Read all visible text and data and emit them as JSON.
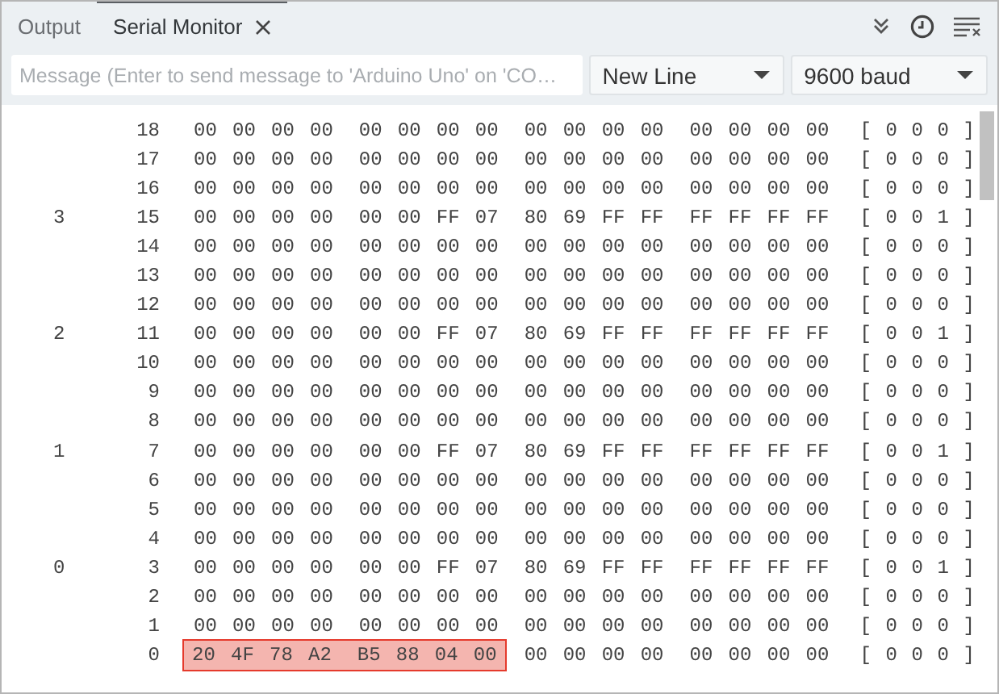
{
  "tabs": [
    {
      "label": "Output",
      "selected": false,
      "closable": false
    },
    {
      "label": "Serial Monitor",
      "selected": true,
      "closable": true
    }
  ],
  "toolbar": {
    "message_field": {
      "placeholder": "Message (Enter to send message to 'Arduino Uno' on 'CO…"
    },
    "line_ending": {
      "value": "New Line"
    },
    "baud_rate": {
      "value": "9600 baud"
    }
  },
  "output": {
    "rows": [
      {
        "sector": "",
        "block": "18",
        "groups": [
          {
            "text": "00 00 00 00",
            "highlighted": false
          },
          {
            "text": "00 00 00 00",
            "highlighted": false
          },
          {
            "text": "00 00 00 00",
            "highlighted": false
          },
          {
            "text": "00 00 00 00",
            "highlighted": false
          }
        ],
        "access": "[ 0 0 0 ]"
      },
      {
        "sector": "",
        "block": "17",
        "groups": [
          {
            "text": "00 00 00 00",
            "highlighted": false
          },
          {
            "text": "00 00 00 00",
            "highlighted": false
          },
          {
            "text": "00 00 00 00",
            "highlighted": false
          },
          {
            "text": "00 00 00 00",
            "highlighted": false
          }
        ],
        "access": "[ 0 0 0 ]"
      },
      {
        "sector": "",
        "block": "16",
        "groups": [
          {
            "text": "00 00 00 00",
            "highlighted": false
          },
          {
            "text": "00 00 00 00",
            "highlighted": false
          },
          {
            "text": "00 00 00 00",
            "highlighted": false
          },
          {
            "text": "00 00 00 00",
            "highlighted": false
          }
        ],
        "access": "[ 0 0 0 ]"
      },
      {
        "sector": "3",
        "block": "15",
        "groups": [
          {
            "text": "00 00 00 00",
            "highlighted": false
          },
          {
            "text": "00 00 FF 07",
            "highlighted": false
          },
          {
            "text": "80 69 FF FF",
            "highlighted": false
          },
          {
            "text": "FF FF FF FF",
            "highlighted": false
          }
        ],
        "access": "[ 0 0 1 ]"
      },
      {
        "sector": "",
        "block": "14",
        "groups": [
          {
            "text": "00 00 00 00",
            "highlighted": false
          },
          {
            "text": "00 00 00 00",
            "highlighted": false
          },
          {
            "text": "00 00 00 00",
            "highlighted": false
          },
          {
            "text": "00 00 00 00",
            "highlighted": false
          }
        ],
        "access": "[ 0 0 0 ]"
      },
      {
        "sector": "",
        "block": "13",
        "groups": [
          {
            "text": "00 00 00 00",
            "highlighted": false
          },
          {
            "text": "00 00 00 00",
            "highlighted": false
          },
          {
            "text": "00 00 00 00",
            "highlighted": false
          },
          {
            "text": "00 00 00 00",
            "highlighted": false
          }
        ],
        "access": "[ 0 0 0 ]"
      },
      {
        "sector": "",
        "block": "12",
        "groups": [
          {
            "text": "00 00 00 00",
            "highlighted": false
          },
          {
            "text": "00 00 00 00",
            "highlighted": false
          },
          {
            "text": "00 00 00 00",
            "highlighted": false
          },
          {
            "text": "00 00 00 00",
            "highlighted": false
          }
        ],
        "access": "[ 0 0 0 ]"
      },
      {
        "sector": "2",
        "block": "11",
        "groups": [
          {
            "text": "00 00 00 00",
            "highlighted": false
          },
          {
            "text": "00 00 FF 07",
            "highlighted": false
          },
          {
            "text": "80 69 FF FF",
            "highlighted": false
          },
          {
            "text": "FF FF FF FF",
            "highlighted": false
          }
        ],
        "access": "[ 0 0 1 ]"
      },
      {
        "sector": "",
        "block": "10",
        "groups": [
          {
            "text": "00 00 00 00",
            "highlighted": false
          },
          {
            "text": "00 00 00 00",
            "highlighted": false
          },
          {
            "text": "00 00 00 00",
            "highlighted": false
          },
          {
            "text": "00 00 00 00",
            "highlighted": false
          }
        ],
        "access": "[ 0 0 0 ]"
      },
      {
        "sector": "",
        "block": "9",
        "groups": [
          {
            "text": "00 00 00 00",
            "highlighted": false
          },
          {
            "text": "00 00 00 00",
            "highlighted": false
          },
          {
            "text": "00 00 00 00",
            "highlighted": false
          },
          {
            "text": "00 00 00 00",
            "highlighted": false
          }
        ],
        "access": "[ 0 0 0 ]"
      },
      {
        "sector": "",
        "block": "8",
        "groups": [
          {
            "text": "00 00 00 00",
            "highlighted": false
          },
          {
            "text": "00 00 00 00",
            "highlighted": false
          },
          {
            "text": "00 00 00 00",
            "highlighted": false
          },
          {
            "text": "00 00 00 00",
            "highlighted": false
          }
        ],
        "access": "[ 0 0 0 ]"
      },
      {
        "sector": "1",
        "block": "7",
        "groups": [
          {
            "text": "00 00 00 00",
            "highlighted": false
          },
          {
            "text": "00 00 FF 07",
            "highlighted": false
          },
          {
            "text": "80 69 FF FF",
            "highlighted": false
          },
          {
            "text": "FF FF FF FF",
            "highlighted": false
          }
        ],
        "access": "[ 0 0 1 ]"
      },
      {
        "sector": "",
        "block": "6",
        "groups": [
          {
            "text": "00 00 00 00",
            "highlighted": false
          },
          {
            "text": "00 00 00 00",
            "highlighted": false
          },
          {
            "text": "00 00 00 00",
            "highlighted": false
          },
          {
            "text": "00 00 00 00",
            "highlighted": false
          }
        ],
        "access": "[ 0 0 0 ]"
      },
      {
        "sector": "",
        "block": "5",
        "groups": [
          {
            "text": "00 00 00 00",
            "highlighted": false
          },
          {
            "text": "00 00 00 00",
            "highlighted": false
          },
          {
            "text": "00 00 00 00",
            "highlighted": false
          },
          {
            "text": "00 00 00 00",
            "highlighted": false
          }
        ],
        "access": "[ 0 0 0 ]"
      },
      {
        "sector": "",
        "block": "4",
        "groups": [
          {
            "text": "00 00 00 00",
            "highlighted": false
          },
          {
            "text": "00 00 00 00",
            "highlighted": false
          },
          {
            "text": "00 00 00 00",
            "highlighted": false
          },
          {
            "text": "00 00 00 00",
            "highlighted": false
          }
        ],
        "access": "[ 0 0 0 ]"
      },
      {
        "sector": "0",
        "block": "3",
        "groups": [
          {
            "text": "00 00 00 00",
            "highlighted": false
          },
          {
            "text": "00 00 FF 07",
            "highlighted": false
          },
          {
            "text": "80 69 FF FF",
            "highlighted": false
          },
          {
            "text": "FF FF FF FF",
            "highlighted": false
          }
        ],
        "access": "[ 0 0 1 ]"
      },
      {
        "sector": "",
        "block": "2",
        "groups": [
          {
            "text": "00 00 00 00",
            "highlighted": false
          },
          {
            "text": "00 00 00 00",
            "highlighted": false
          },
          {
            "text": "00 00 00 00",
            "highlighted": false
          },
          {
            "text": "00 00 00 00",
            "highlighted": false
          }
        ],
        "access": "[ 0 0 0 ]"
      },
      {
        "sector": "",
        "block": "1",
        "groups": [
          {
            "text": "00 00 00 00",
            "highlighted": false
          },
          {
            "text": "00 00 00 00",
            "highlighted": false
          },
          {
            "text": "00 00 00 00",
            "highlighted": false
          },
          {
            "text": "00 00 00 00",
            "highlighted": false
          }
        ],
        "access": "[ 0 0 0 ]"
      },
      {
        "sector": "",
        "block": "0",
        "groups": [
          {
            "text": "20 4F 78 A2",
            "highlighted": true
          },
          {
            "text": "B5 88 04 00",
            "highlighted": true
          },
          {
            "text": "00 00 00 00",
            "highlighted": false
          },
          {
            "text": "00 00 00 00",
            "highlighted": false
          }
        ],
        "access": "[ 0 0 0 ]"
      }
    ]
  }
}
